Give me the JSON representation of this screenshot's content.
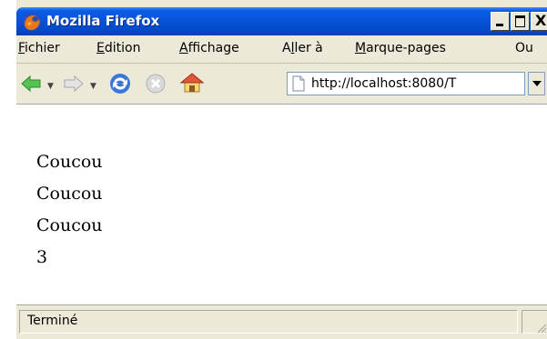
{
  "window": {
    "title": "Mozilla Firefox"
  },
  "titlebar": {
    "close_glyph": "X"
  },
  "menu": {
    "items": [
      {
        "pre": "",
        "u": "F",
        "post": "ichier"
      },
      {
        "pre": "",
        "u": "E",
        "post": "dition"
      },
      {
        "pre": "",
        "u": "A",
        "post": "ffichage"
      },
      {
        "pre": "A",
        "u": "l",
        "post": "ler à"
      },
      {
        "pre": "",
        "u": "M",
        "post": "arque-pages"
      },
      {
        "pre": "Ou",
        "u": "",
        "post": ""
      }
    ]
  },
  "toolbar": {
    "back_icon": "back-arrow-icon",
    "forward_icon": "forward-arrow-icon",
    "reload_icon": "reload-icon",
    "stop_icon": "stop-icon",
    "home_icon": "home-icon"
  },
  "address": {
    "url": "http://localhost:8080/T"
  },
  "content": {
    "lines": [
      "Coucou",
      "Coucou",
      "Coucou",
      "3"
    ]
  },
  "status": {
    "text": "Terminé"
  },
  "colors": {
    "titlebar": "#0753d6",
    "chrome": "#ece9d8",
    "back_arrow": "#3cb043",
    "reload": "#3a78d8"
  }
}
